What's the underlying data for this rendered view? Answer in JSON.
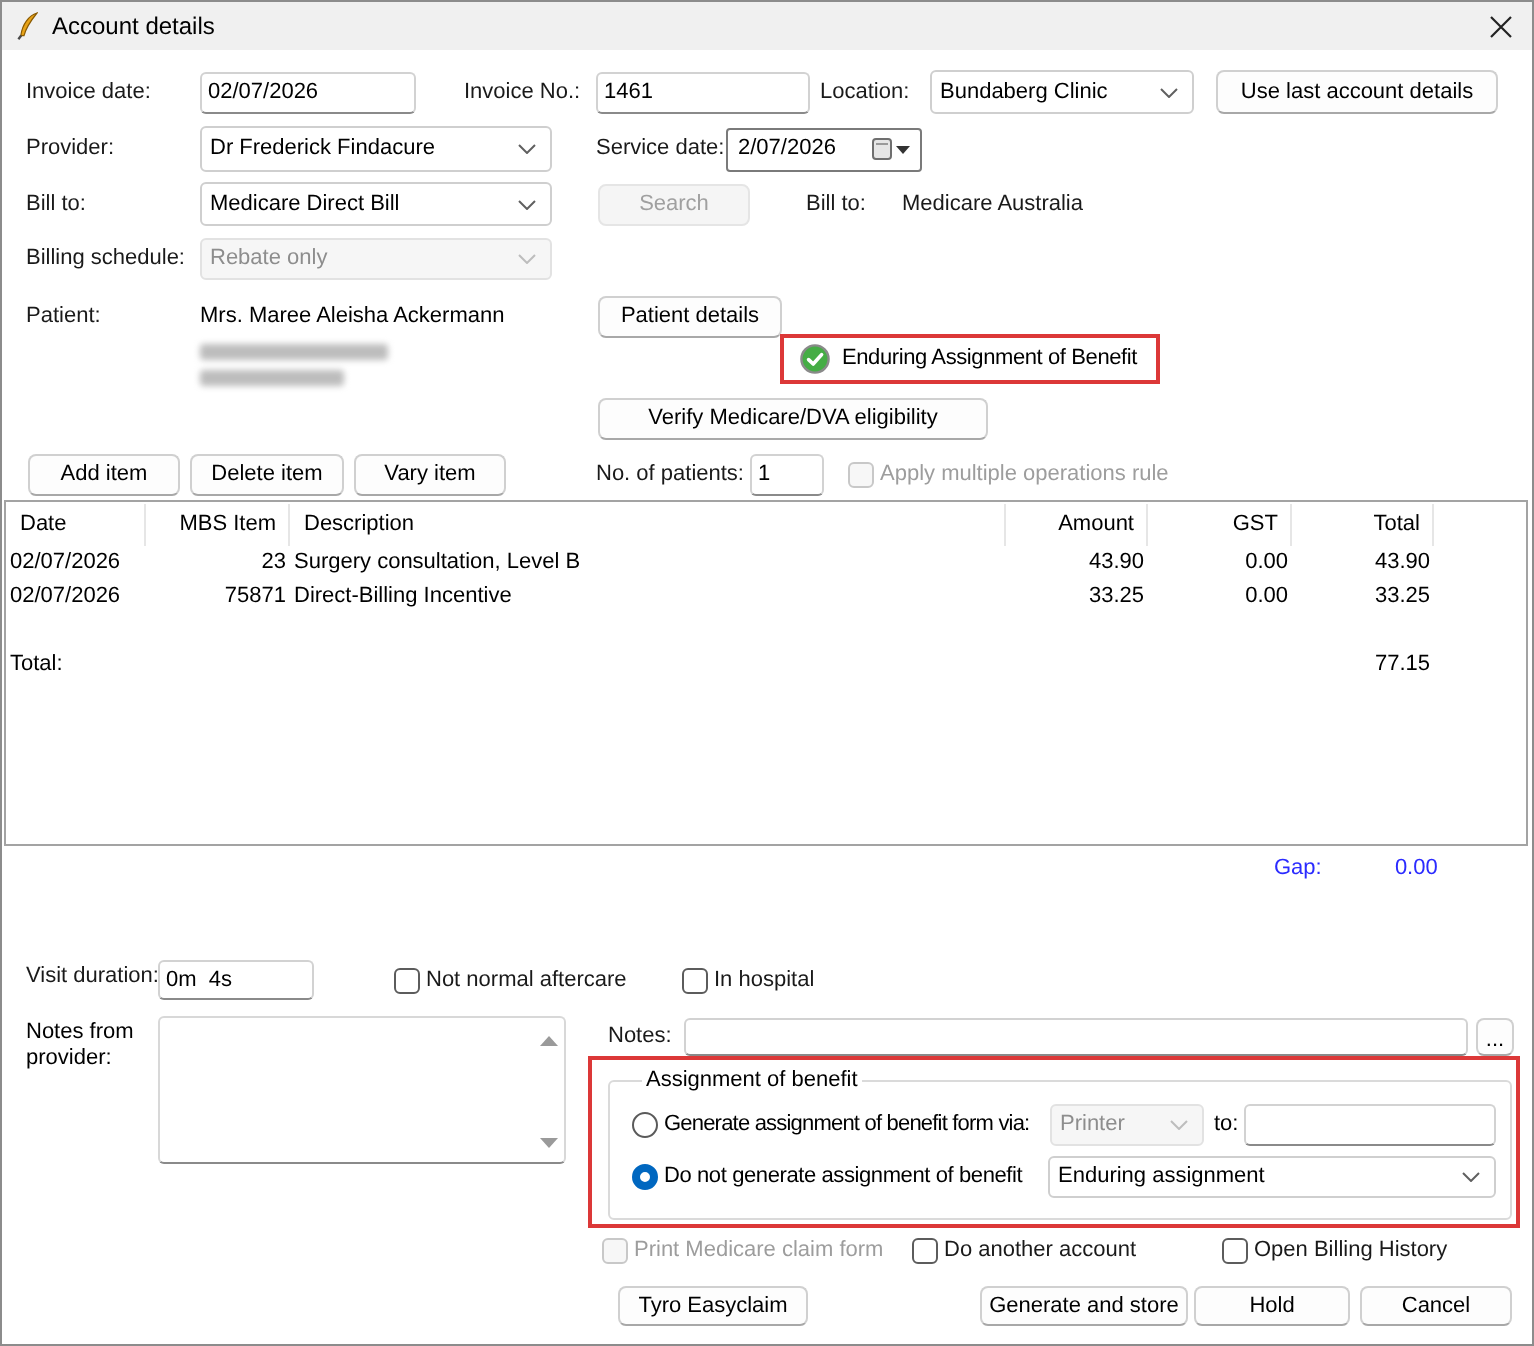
{
  "window": {
    "title": "Account details"
  },
  "invoice_date": {
    "label": "Invoice date:",
    "value": "02/07/2026"
  },
  "invoice_no": {
    "label": "Invoice No.:",
    "value": "1461"
  },
  "location": {
    "label": "Location:",
    "value": "Bundaberg Clinic"
  },
  "use_last_button": {
    "label": "Use last account details"
  },
  "provider": {
    "label": "Provider:",
    "value": "Dr Frederick Findacure"
  },
  "service_date": {
    "label": "Service date:",
    "value": "2/07/2026"
  },
  "bill_to": {
    "label": "Bill to:",
    "value": "Medicare Direct Bill"
  },
  "search_button": {
    "label": "Search",
    "disabled": true
  },
  "bill_to_info": {
    "label": "Bill to:",
    "value": "Medicare Australia"
  },
  "billing_schedule": {
    "label": "Billing schedule:",
    "value": "Rebate only",
    "disabled": true
  },
  "patient": {
    "label": "Patient:",
    "name": "Mrs. Maree Aleisha Ackermann",
    "address_blurred": true
  },
  "patient_details_button": {
    "label": "Patient details"
  },
  "eab_status": {
    "text": "Enduring Assignment of Benefit",
    "highlighted": true
  },
  "verify_button": {
    "label": "Verify Medicare/DVA eligibility"
  },
  "item_buttons": [
    {
      "label": "Add item"
    },
    {
      "label": "Delete item"
    },
    {
      "label": "Vary item"
    }
  ],
  "patients_count": {
    "label": "No. of patients:",
    "value": "1"
  },
  "multiple_operations": {
    "label": "Apply multiple operations rule",
    "checked": false,
    "disabled": true
  },
  "table": {
    "columns": [
      "Date",
      "MBS Item",
      "Description",
      "Amount",
      "GST",
      "Total"
    ],
    "rows": [
      [
        "02/07/2026",
        "23",
        "Surgery consultation, Level B",
        "43.90",
        "0.00",
        "43.90"
      ],
      [
        "02/07/2026",
        "75871",
        "Direct-Billing Incentive",
        "33.25",
        "0.00",
        "33.25"
      ]
    ],
    "total": {
      "label": "Total:",
      "value": "77.15"
    }
  },
  "gap": {
    "label": "Gap:",
    "value": "0.00"
  },
  "visit_duration": {
    "label": "Visit duration:",
    "value": "0m  4s"
  },
  "visit_options": [
    {
      "label": "Not normal aftercare",
      "checked": false
    },
    {
      "label": "In hospital",
      "checked": false
    }
  ],
  "provider_notes": {
    "label": "Notes from provider:"
  },
  "notes": {
    "label": "Notes:",
    "more_button": "..."
  },
  "assignment": {
    "title": "Assignment of benefit",
    "highlighted": true,
    "options": [
      {
        "kind": "send",
        "label": "Generate assignment of benefit form via:",
        "selected": false,
        "method": "Printer",
        "method_disabled": true,
        "to_label": "to:"
      },
      {
        "kind": "reason",
        "label": "Do not generate assignment of benefit",
        "selected": true,
        "reason": "Enduring assignment"
      }
    ]
  },
  "after_options": [
    {
      "label": "Print Medicare claim form",
      "checked": false,
      "disabled": true
    },
    {
      "label": "Do another account",
      "checked": false,
      "disabled": false
    },
    {
      "label": "Open Billing History",
      "checked": false,
      "disabled": false
    }
  ],
  "secondary_button": {
    "label": "Tyro Easyclaim"
  },
  "action_buttons": [
    {
      "label": "Generate and store"
    },
    {
      "label": "Hold"
    },
    {
      "label": "Cancel"
    }
  ]
}
